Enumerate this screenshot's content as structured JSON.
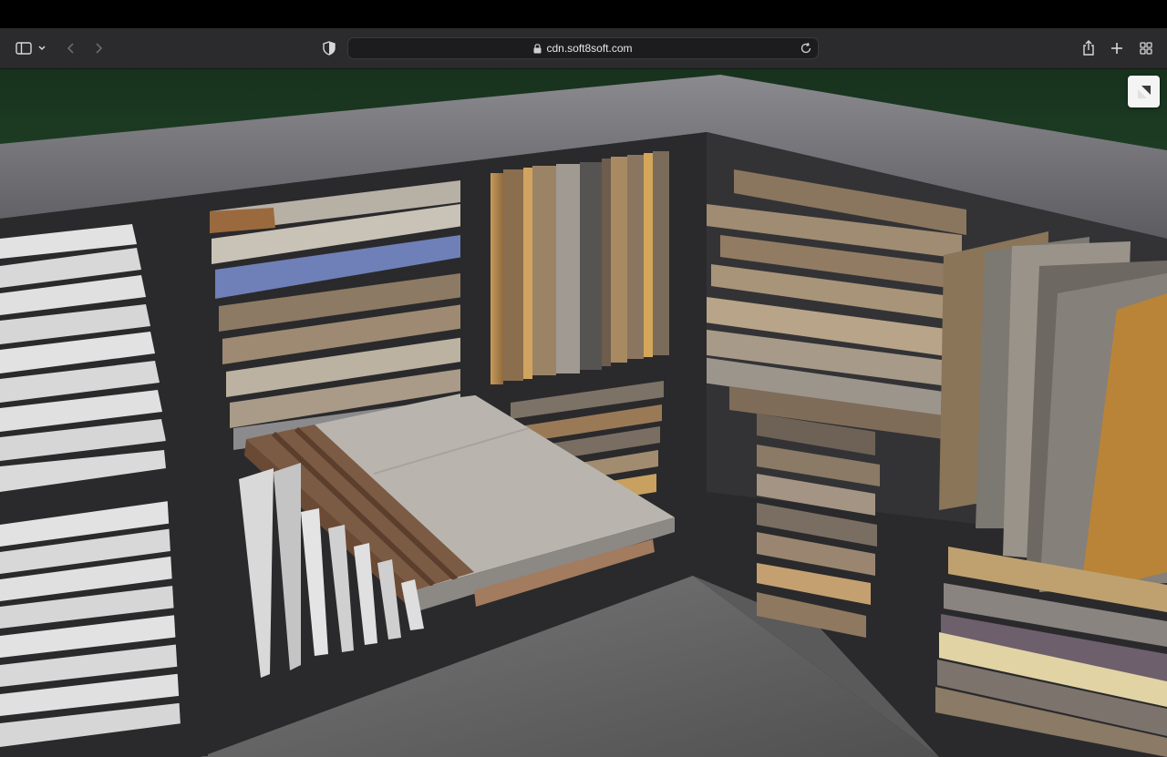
{
  "browser": {
    "url": "cdn.soft8soft.com",
    "icons": {
      "sidebar": "sidebar-icon",
      "chevron": "chevron-down-icon",
      "back": "back-arrow-icon",
      "forward": "forward-arrow-icon",
      "privacy": "privacy-shield-icon",
      "lock": "lock-icon",
      "reload": "reload-icon",
      "share": "share-icon",
      "new_tab": "plus-icon",
      "tabs": "tab-overview-icon"
    }
  },
  "viewer": {
    "fullscreen_icon": "fullscreen-toggle-icon",
    "colors": {
      "background_grass": "#1f3a26",
      "counter_top": "#6e6e72",
      "cabinet": "#2a2a2c",
      "floor": "#6a6a6a"
    }
  }
}
